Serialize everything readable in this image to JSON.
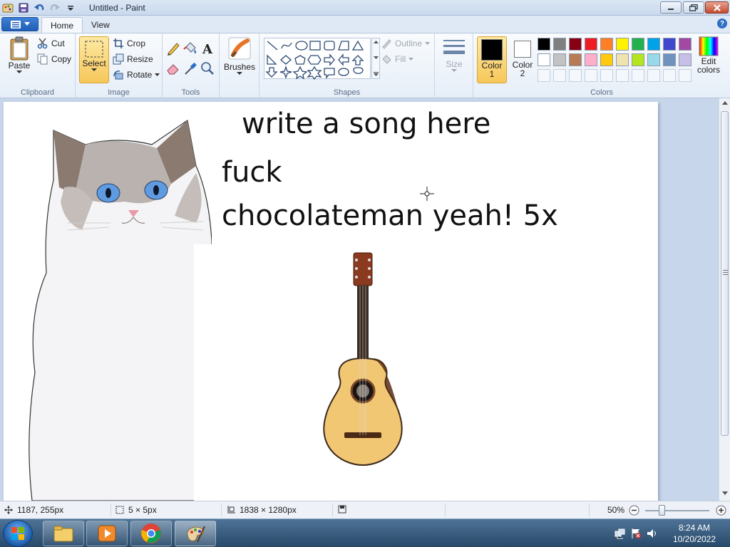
{
  "window": {
    "title": "Untitled - Paint"
  },
  "tabs": [
    {
      "label": "Home"
    },
    {
      "label": "View"
    }
  ],
  "ribbon": {
    "clipboard": {
      "group_label": "Clipboard",
      "paste": "Paste",
      "cut": "Cut",
      "copy": "Copy"
    },
    "image": {
      "group_label": "Image",
      "select": "Select",
      "crop": "Crop",
      "resize": "Resize",
      "rotate": "Rotate"
    },
    "tools": {
      "group_label": "Tools"
    },
    "brushes": {
      "label": "Brushes"
    },
    "shapes": {
      "group_label": "Shapes",
      "outline": "Outline",
      "fill": "Fill"
    },
    "size": {
      "label": "Size"
    },
    "colors": {
      "group_label": "Colors",
      "color1_label": "Color",
      "color1_num": "1",
      "color2_label": "Color",
      "color2_num": "2",
      "edit_colors_1": "Edit",
      "edit_colors_2": "colors",
      "color1": "#000000",
      "color2": "#ffffff",
      "palette_row1": [
        "#000000",
        "#7f7f7f",
        "#880015",
        "#ed1c24",
        "#ff7f27",
        "#fff200",
        "#22b14c",
        "#00a2e8",
        "#3f48cc",
        "#a349a4"
      ],
      "palette_row2": [
        "#ffffff",
        "#c3c3c3",
        "#b97a57",
        "#ffaec9",
        "#ffc90e",
        "#efe4b0",
        "#b5e61d",
        "#99d9ea",
        "#7092be",
        "#c8bfe7"
      ]
    }
  },
  "canvas": {
    "title_text": "write a song here",
    "line1": "fuck",
    "line2": "chocolateman yeah! 5x"
  },
  "status": {
    "cursor_pos": "1187, 255px",
    "selection_size": "5 × 5px",
    "image_size": "1838 × 1280px",
    "zoom": "50%"
  },
  "taskbar": {
    "time": "8:24 AM",
    "date": "10/20/2022"
  }
}
